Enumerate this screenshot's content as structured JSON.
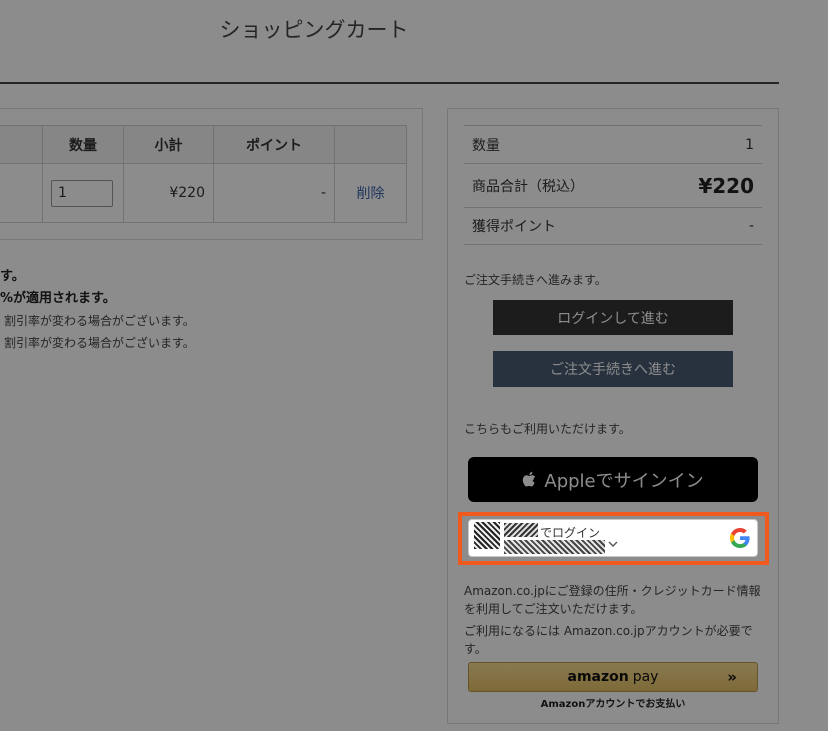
{
  "page": {
    "title": "ショッピングカート"
  },
  "cart": {
    "headers": {
      "quantity": "数量",
      "subtotal": "小計",
      "points": "ポイント"
    },
    "item": {
      "quantity": "1",
      "subtotal": "¥220",
      "points": "-",
      "delete": "削除"
    }
  },
  "notes": [
    "す。",
    "%が適用されます。",
    "割引率が変わる場合がございます。",
    "割引率が変わる場合がございます。"
  ],
  "summary": {
    "quantity_label": "数量",
    "quantity_value": "1",
    "total_label": "商品合計（税込）",
    "total_value": "¥220",
    "points_label": "獲得ポイント",
    "points_value": "-"
  },
  "checkout": {
    "prompt": "ご注文手続きへ進みます。",
    "login_button": "ログインして進む",
    "order_button": "ご注文手続きへ進む",
    "alt_prompt": "こちらもご利用いただけます。",
    "apple_button": "Appleでサインイン",
    "google_label": "でログイン"
  },
  "amazon": {
    "text1": "Amazon.co.jpにご登録の住所・クレジットカード情報を利用してご注文いただけます。",
    "text2": "ご利用になるには Amazon.co.jpアカウントが必要です。",
    "logo_word": "amazon",
    "pay_word": "pay",
    "arrows": "»",
    "caption": "Amazonアカウントでお支払い"
  },
  "colors": {
    "highlight": "#f15a1e",
    "login_btn": "#333333",
    "order_btn": "#4a5a72"
  }
}
